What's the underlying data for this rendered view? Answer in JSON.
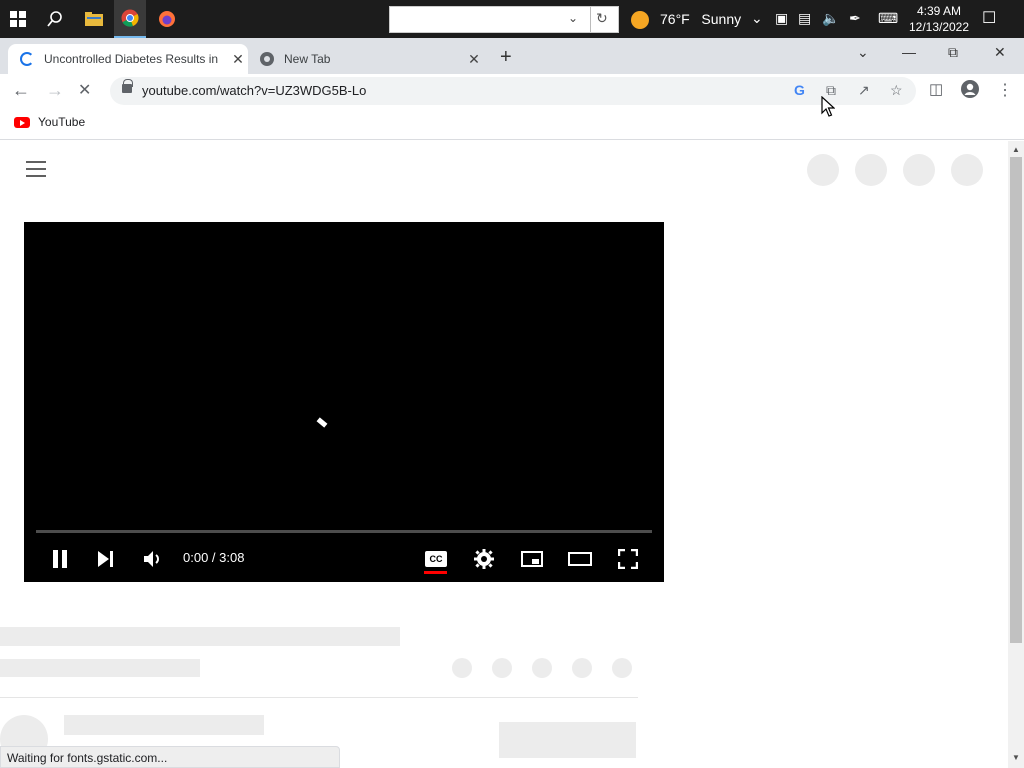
{
  "taskbar": {
    "weather_temp": "76°F",
    "weather_condition": "Sunny",
    "clock_time": "4:39 AM",
    "clock_date": "12/13/2022"
  },
  "tabs": [
    {
      "title": "Uncontrolled Diabetes Results in",
      "state": "loading"
    },
    {
      "title": "New Tab"
    }
  ],
  "toolbar": {
    "url": "youtube.com/watch?v=UZ3WDG5B-Lo"
  },
  "bookmarks": [
    {
      "label": "YouTube"
    }
  ],
  "player": {
    "time_display": "0:00 / 3:08"
  },
  "status": {
    "text": "Waiting for fonts.gstatic.com..."
  }
}
